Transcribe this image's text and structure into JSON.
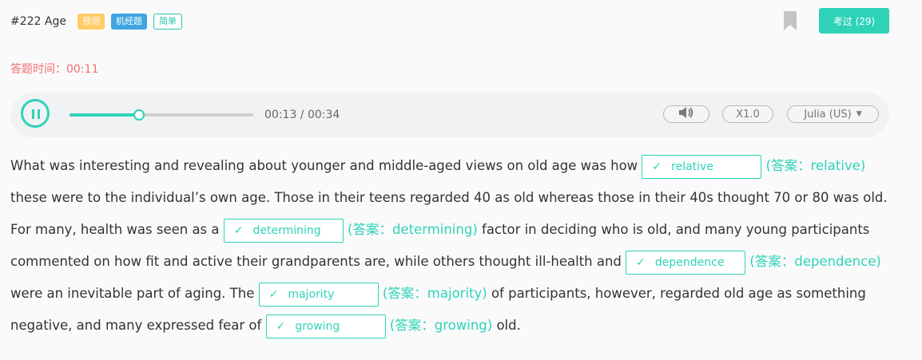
{
  "header": {
    "title": "#222 Age",
    "tags": [
      "预测",
      "机经题",
      "简单"
    ],
    "passed_button": "考过 (29)"
  },
  "timer": {
    "label": "答题时间：",
    "value": "00:11"
  },
  "player": {
    "progress": 0.38,
    "time": "00:13 / 00:34",
    "speed": "X1.0",
    "voice": "Julia (US)"
  },
  "passage": {
    "t1": "What was interesting and revealing about younger and middle-aged views on old age was how ",
    "t2": " these were to the individual’s own age. Those in their teens regarded 40 as old whereas those in their 40s thought 70 or 80 was old. For many, health was seen as a ",
    "t3": " factor in deciding who is old, and many young participants commented on how fit and active their grandparents are, while others thought ill-health and ",
    "t4": " were an inevitable part of aging. The ",
    "t5": " of participants, however, regarded old age as something negative, and many expressed fear of ",
    "t6": " old.",
    "blanks": [
      {
        "value": "relative",
        "answer": "(答案：relative)"
      },
      {
        "value": "determining",
        "answer": "(答案：determining)"
      },
      {
        "value": "dependence",
        "answer": "(答案：dependence)"
      },
      {
        "value": "majority",
        "answer": "(答案：majority)"
      },
      {
        "value": "growing",
        "answer": "(答案：growing)"
      }
    ]
  },
  "icons": {
    "check": "check-icon",
    "bookmark": "bookmark-icon",
    "volume": "volume-icon",
    "pause": "pause-icon"
  }
}
